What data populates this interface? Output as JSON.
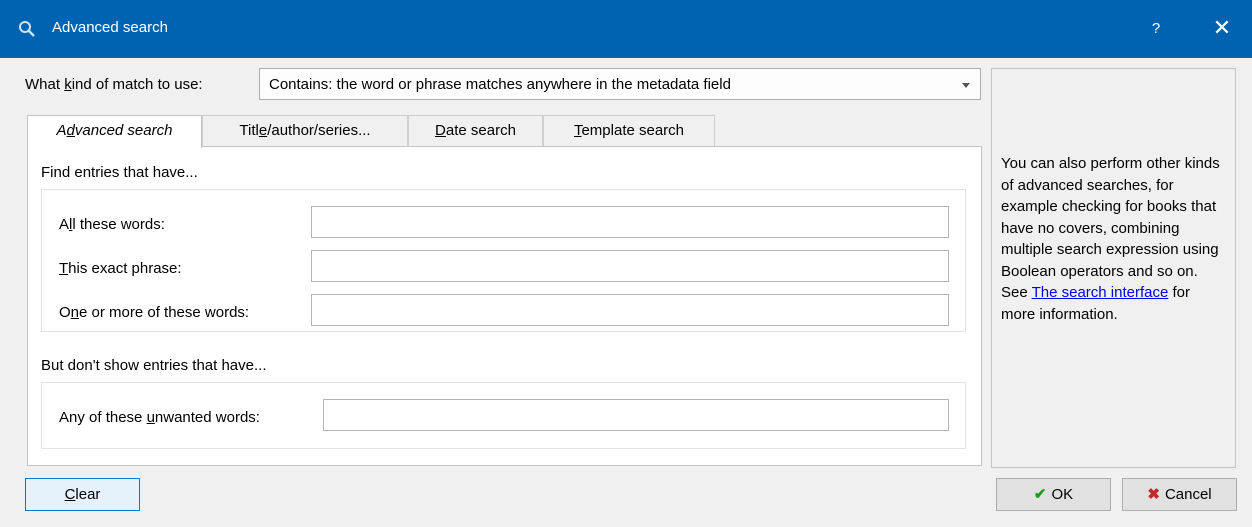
{
  "window": {
    "title": "Advanced search",
    "help_label": "?",
    "close_label": "✕",
    "title_icon": "search-icon"
  },
  "match": {
    "label": "What kind of match to use:",
    "value": "Contains: the word or phrase matches anywhere in the metadata field"
  },
  "tabs": [
    {
      "label": "Advanced search"
    },
    {
      "label": "Title/author/series..."
    },
    {
      "label": "Date search"
    },
    {
      "label": "Template search"
    }
  ],
  "find_section": {
    "title": "Find entries that have...",
    "all_words_label": "All these words:",
    "all_words_value": "",
    "exact_phrase_label": "This exact phrase:",
    "exact_phrase_value": "",
    "one_or_more_label": "One or more of these words:",
    "one_or_more_value": ""
  },
  "exclude_section": {
    "title": "But don't show entries that have...",
    "unwanted_label": "Any of these unwanted words:",
    "unwanted_value": ""
  },
  "side_note": {
    "text_before": "You can also perform other kinds of advanced searches, for example checking for books that have no covers, combining multiple search expression using Boolean operators and so on. See ",
    "link": "The search interface",
    "text_after": " for more information."
  },
  "buttons": {
    "clear": "Clear",
    "ok": "OK",
    "cancel": "Cancel"
  },
  "colors": {
    "titlebar": "#0063b1",
    "ok_check": "#1a9c1a",
    "cancel_x": "#c62828",
    "link": "#0000ee"
  }
}
